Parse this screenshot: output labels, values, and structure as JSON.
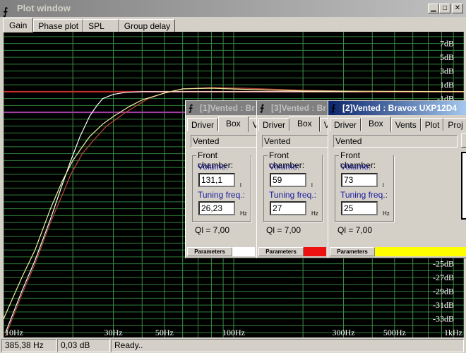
{
  "window": {
    "title": "Plot window",
    "buttons": [
      "minimize",
      "maximize",
      "close"
    ]
  },
  "tabs": [
    {
      "label": "Gain",
      "selected": true
    },
    {
      "label": "Phase plot"
    },
    {
      "label": "SPL"
    },
    {
      "label": "Group delay"
    }
  ],
  "status": {
    "freq": "385,38 Hz",
    "gain": "0,03 dB",
    "message": "Ready.."
  },
  "chart_data": {
    "type": "line",
    "xscale": "log",
    "xlim": [
      10,
      1000
    ],
    "ylim": [
      -35.7,
      8.7
    ],
    "grid": true,
    "x_tick_labels": [
      {
        "v": 10,
        "t": "10Hz"
      },
      {
        "v": 30,
        "t": "30Hz"
      },
      {
        "v": 50,
        "t": "50Hz"
      },
      {
        "v": 100,
        "t": "100Hz"
      },
      {
        "v": 300,
        "t": "300Hz"
      },
      {
        "v": 500,
        "t": "500Hz"
      },
      {
        "v": 1000,
        "t": "1kHz"
      }
    ],
    "y_tick_labels": [
      {
        "v": 7,
        "t": "7dB"
      },
      {
        "v": 5,
        "t": "5dB"
      },
      {
        "v": 3,
        "t": "3dB"
      },
      {
        "v": 1,
        "t": "1dB"
      },
      {
        "v": -1,
        "t": "-1dB"
      },
      {
        "v": -25,
        "t": "-25dB"
      },
      {
        "v": -27,
        "t": "-27dB"
      },
      {
        "v": -29,
        "t": "-29dB"
      },
      {
        "v": -31,
        "t": "-31dB"
      },
      {
        "v": -33,
        "t": "-33dB"
      }
    ],
    "reference_lines": [
      {
        "y": 0,
        "color": "#c8302a"
      },
      {
        "y": -3,
        "color": "#a040a0"
      }
    ],
    "series": [
      {
        "color": "#ffffff",
        "points": [
          [
            10.2,
            -35
          ],
          [
            12,
            -29
          ],
          [
            13.7,
            -24.5
          ],
          [
            16,
            -18.5
          ],
          [
            18,
            -13.5
          ],
          [
            19.6,
            -10
          ],
          [
            21.5,
            -6.5
          ],
          [
            23.7,
            -3.5
          ],
          [
            25.5,
            -2
          ],
          [
            27,
            -1
          ],
          [
            30,
            -0.4
          ],
          [
            34,
            -0.1
          ],
          [
            40,
            0
          ],
          [
            1000,
            0
          ]
        ]
      },
      {
        "color": "#c04a3a",
        "points": [
          [
            10.2,
            -35.5
          ],
          [
            12,
            -29.5
          ],
          [
            13.7,
            -25
          ],
          [
            16,
            -19
          ],
          [
            18,
            -15
          ],
          [
            19.6,
            -12
          ],
          [
            22,
            -9
          ],
          [
            24.7,
            -7
          ],
          [
            28,
            -5
          ],
          [
            33.6,
            -3.1
          ],
          [
            38,
            -2
          ],
          [
            42.6,
            -1
          ],
          [
            50,
            -0.2
          ],
          [
            60,
            0.4
          ],
          [
            80,
            0.6
          ],
          [
            110,
            0.5
          ],
          [
            200,
            0.2
          ],
          [
            400,
            0
          ],
          [
            1000,
            0
          ]
        ]
      },
      {
        "color": "#f0f0a0",
        "points": [
          [
            10,
            -33
          ],
          [
            12,
            -27
          ],
          [
            13.7,
            -23
          ],
          [
            16,
            -17
          ],
          [
            18,
            -13
          ],
          [
            20,
            -10
          ],
          [
            22,
            -8
          ],
          [
            23.7,
            -6.5
          ],
          [
            27,
            -4.7
          ],
          [
            30,
            -3.6
          ],
          [
            35,
            -2.2
          ],
          [
            40,
            -1.2
          ],
          [
            50,
            -0.2
          ],
          [
            60,
            0.4
          ],
          [
            80,
            0.5
          ],
          [
            120,
            0.3
          ],
          [
            200,
            0.1
          ],
          [
            1000,
            0
          ]
        ]
      }
    ]
  },
  "subwindows": [
    {
      "title": "[1]Vented : Br",
      "tabs": [
        "Driver",
        "Box",
        "V"
      ],
      "type": "Vented",
      "group": "Front chamber:",
      "volume_label": "Volume:",
      "volume": "131,1",
      "volume_unit": "l",
      "tuning_label": "Tuning freq.:",
      "tuning": "26,23",
      "tuning_unit": "Hz",
      "ql": "Ql = 7,00",
      "params": "Parameters",
      "color": "#ffffff"
    },
    {
      "title": "[3]Vented : Br",
      "tabs": [
        "Driver",
        "Box",
        "V"
      ],
      "type": "Vented",
      "group": "Front chamber:",
      "volume_label": "Volume:",
      "volume": "59",
      "volume_unit": "l",
      "tuning_label": "Tuning freq.:",
      "tuning": "27",
      "tuning_unit": "Hz",
      "ql": "Ql = 7,00",
      "params": "Parameters",
      "color": "#ee1111"
    },
    {
      "title": "[2]Vented : Bravox UXP12D4",
      "tabs": [
        "Driver",
        "Box",
        "Vents",
        "Plot",
        "Proj"
      ],
      "type": "Vented",
      "group": "Front chamber:",
      "volume_label": "Volume:",
      "volume": "73",
      "volume_unit": "l",
      "tuning_label": "Tuning freq.:",
      "tuning": "25",
      "tuning_unit": "Hz",
      "ql": "Ql = 7,00",
      "params": "Parameters",
      "color": "#ffff00",
      "active": true
    }
  ]
}
